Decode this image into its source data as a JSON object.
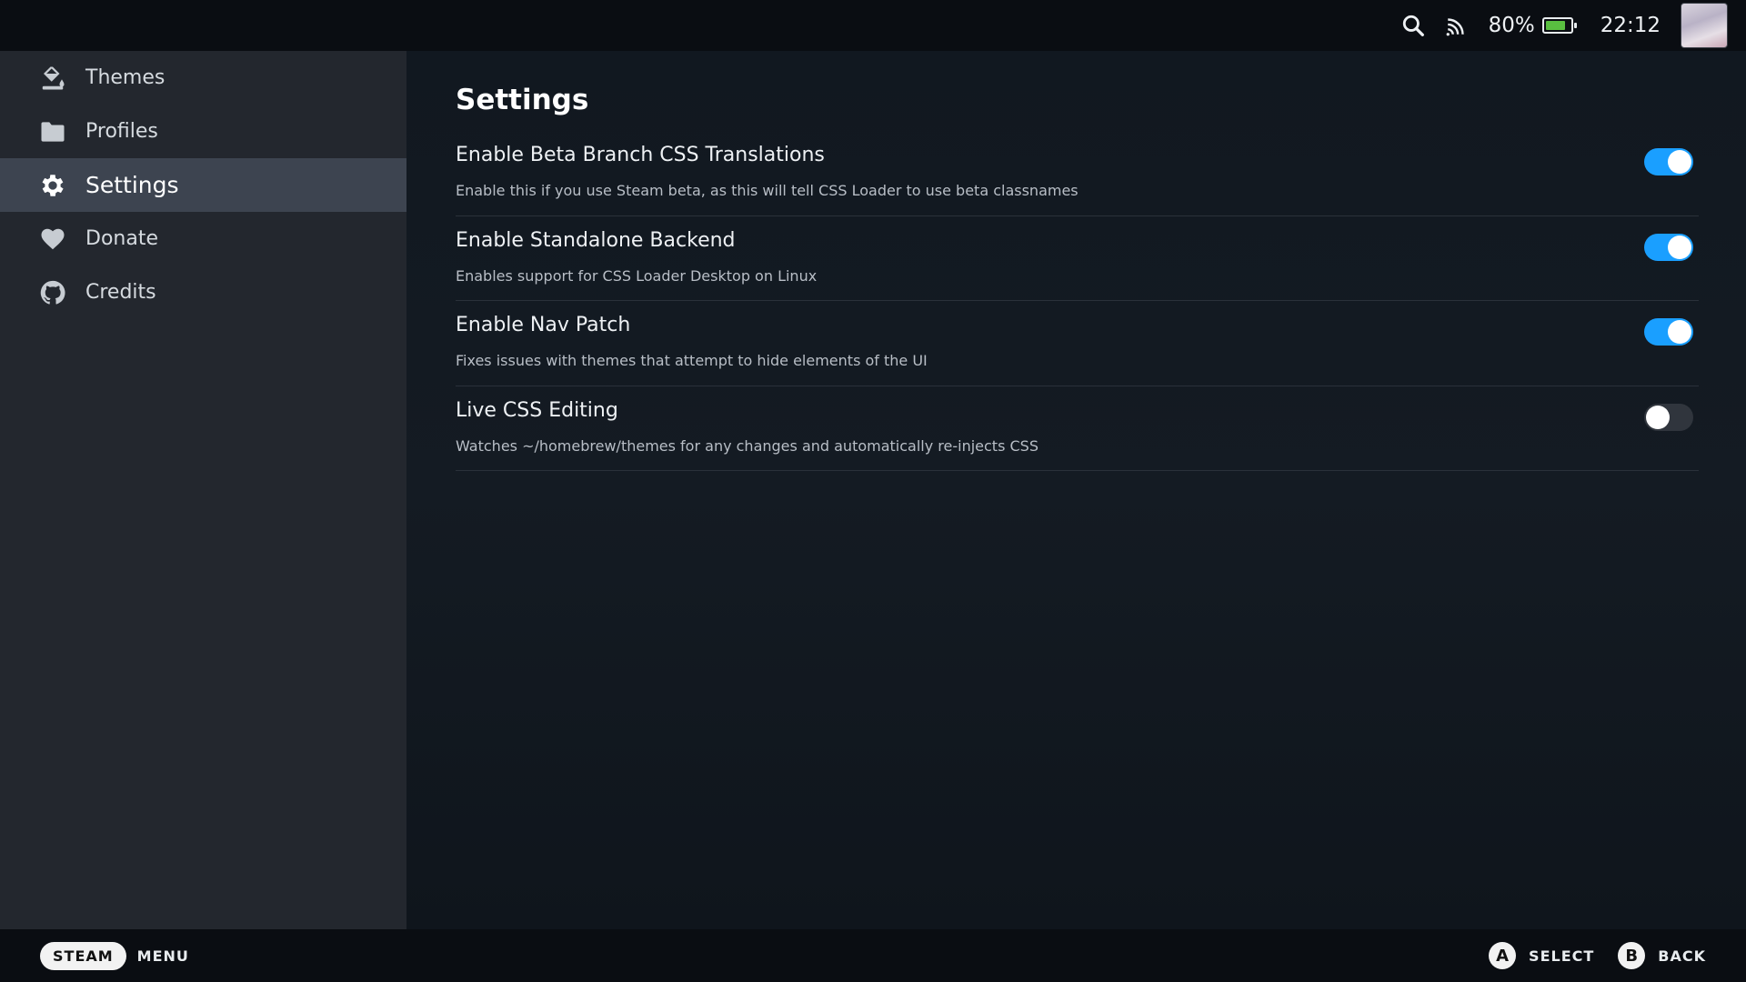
{
  "status_bar": {
    "battery_percent_label": "80%",
    "battery_level": 0.8,
    "time": "22:12",
    "icons": [
      "search-icon",
      "cast-icon",
      "battery-icon",
      "avatar"
    ]
  },
  "sidebar": {
    "items": [
      {
        "label": "Themes",
        "icon": "paint-bucket-icon",
        "active": false
      },
      {
        "label": "Profiles",
        "icon": "folder-icon",
        "active": false
      },
      {
        "label": "Settings",
        "icon": "gear-icon",
        "active": true
      },
      {
        "label": "Donate",
        "icon": "heart-icon",
        "active": false
      },
      {
        "label": "Credits",
        "icon": "github-icon",
        "active": false
      }
    ]
  },
  "main": {
    "title": "Settings",
    "settings": [
      {
        "label": "Enable Beta Branch CSS Translations",
        "description": "Enable this if you use Steam beta, as this will tell CSS Loader to use beta classnames",
        "enabled": true
      },
      {
        "label": "Enable Standalone Backend",
        "description": "Enables support for CSS Loader Desktop on Linux",
        "enabled": true
      },
      {
        "label": "Enable Nav Patch",
        "description": "Fixes issues with themes that attempt to hide elements of the UI",
        "enabled": true
      },
      {
        "label": "Live CSS Editing",
        "description": "Watches ~/homebrew/themes for any changes and automatically re-injects CSS",
        "enabled": false
      }
    ]
  },
  "bottom_bar": {
    "steam_label": "STEAM",
    "menu_label": "MENU",
    "select_button": "A",
    "select_label": "SELECT",
    "back_button": "B",
    "back_label": "BACK"
  },
  "colors": {
    "accent": "#1a9fff",
    "sidebar_bg": "#23272e",
    "sidebar_active": "#3d4450",
    "battery_fill": "#59bf40"
  }
}
